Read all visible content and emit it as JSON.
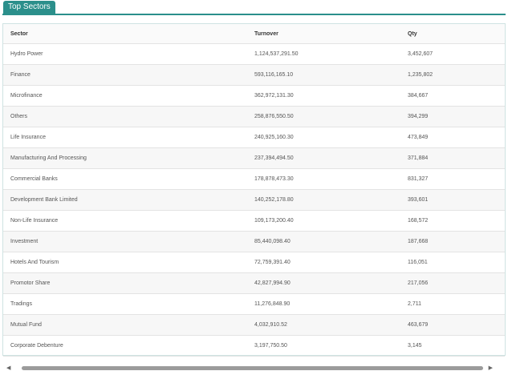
{
  "tab": {
    "label": "Top Sectors"
  },
  "table": {
    "columns": [
      "Sector",
      "Turnover",
      "Qty"
    ],
    "rows": [
      [
        "Hydro Power",
        "1,124,537,291.50",
        "3,452,607"
      ],
      [
        "Finance",
        "593,116,165.10",
        "1,235,802"
      ],
      [
        "Microfinance",
        "362,972,131.30",
        "384,667"
      ],
      [
        "Others",
        "258,876,550.50",
        "394,299"
      ],
      [
        "Life Insurance",
        "240,925,160.30",
        "473,849"
      ],
      [
        "Manufacturing And Processing",
        "237,394,494.50",
        "371,884"
      ],
      [
        "Commercial Banks",
        "178,878,473.30",
        "831,327"
      ],
      [
        "Development Bank Limited",
        "140,252,178.80",
        "393,601"
      ],
      [
        "Non-Life Insurance",
        "109,173,200.40",
        "168,572"
      ],
      [
        "Investment",
        "85,440,098.40",
        "187,668"
      ],
      [
        "Hotels And Tourism",
        "72,759,391.40",
        "116,051"
      ],
      [
        "Promotor Share",
        "42,827,994.90",
        "217,056"
      ],
      [
        "Tradings",
        "11,276,848.90",
        "2,711"
      ],
      [
        "Mutual Fund",
        "4,032,910.52",
        "463,679"
      ],
      [
        "Corporate Debenture",
        "3,197,750.50",
        "3,145"
      ]
    ]
  },
  "scrollbar": {
    "left_icon": "chevron-left-icon",
    "right_icon": "chevron-right-icon"
  },
  "colors": {
    "accent": "#2b8f8b"
  }
}
